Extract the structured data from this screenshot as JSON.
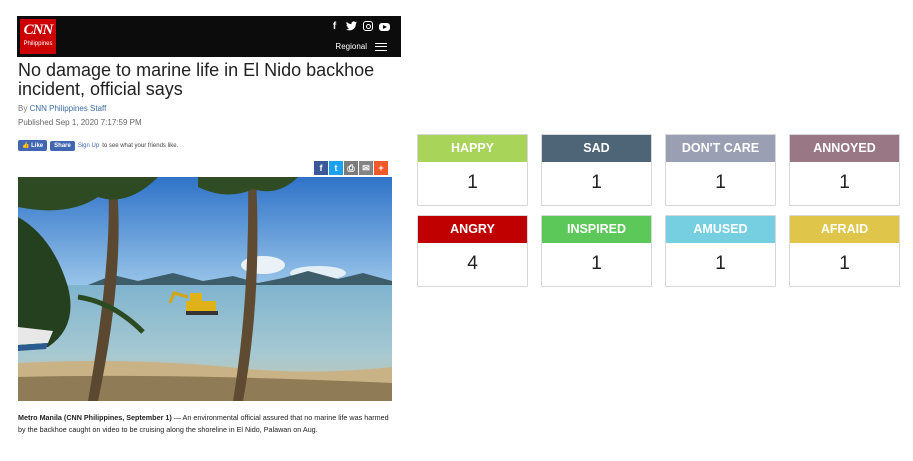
{
  "header": {
    "logo_text": "CNN",
    "logo_sub": "Philippines",
    "social_icons": [
      "facebook-icon",
      "twitter-icon",
      "instagram-icon",
      "youtube-icon"
    ],
    "region_label": "Regional",
    "menu_icon": "hamburger-menu-icon"
  },
  "article": {
    "title": "No damage to marine life in El Nido backhoe incident, official says",
    "byline_prefix": "By ",
    "byline_author": "CNN Philippines Staff",
    "published": "Published Sep 1, 2020 7:17:59 PM",
    "fb_like": "Like",
    "fb_share": "Share",
    "fb_signup": "Sign Up",
    "fb_text": " to see what your friends like.",
    "share_icons": [
      "facebook-icon",
      "twitter-icon",
      "print-icon",
      "email-icon",
      "plus-icon"
    ],
    "lede_dateline": "Metro Manila (CNN Philippines, September 1)",
    "lede_text": " — An environmental official assured that no marine life was harmed by the backhoe caught on video to be cruising along the shoreline in El Nido, Palawan on Aug."
  },
  "reactions": [
    {
      "label": "HAPPY",
      "count": "1",
      "color": "#a8d45a"
    },
    {
      "label": "SAD",
      "count": "1",
      "color": "#4d6577"
    },
    {
      "label": "DON'T CARE",
      "count": "1",
      "color": "#9b9fb3"
    },
    {
      "label": "ANNOYED",
      "count": "1",
      "color": "#9a7785"
    },
    {
      "label": "ANGRY",
      "count": "4",
      "color": "#c00000"
    },
    {
      "label": "INSPIRED",
      "count": "1",
      "color": "#5dc85a"
    },
    {
      "label": "AMUSED",
      "count": "1",
      "color": "#76cfe0"
    },
    {
      "label": "AFRAID",
      "count": "1",
      "color": "#dfc54a"
    }
  ]
}
